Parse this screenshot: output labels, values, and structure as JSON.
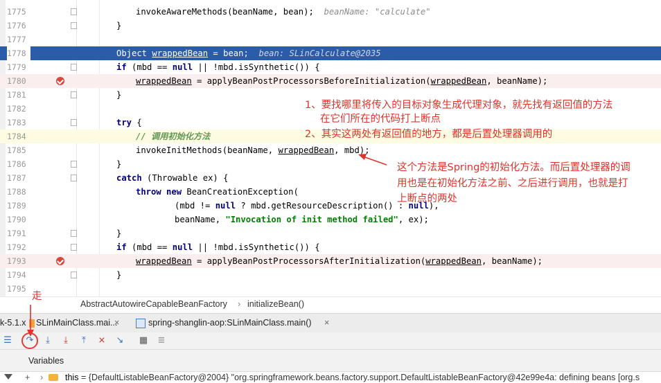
{
  "editor": {
    "lines": [
      {
        "num": "1775"
      },
      {
        "num": "1776"
      },
      {
        "num": "1777"
      },
      {
        "num": "1778"
      },
      {
        "num": "1779"
      },
      {
        "num": "1780"
      },
      {
        "num": "1781"
      },
      {
        "num": "1782"
      },
      {
        "num": "1783"
      },
      {
        "num": "1784"
      },
      {
        "num": "1785"
      },
      {
        "num": "1786"
      },
      {
        "num": "1787"
      },
      {
        "num": "1788"
      },
      {
        "num": "1789"
      },
      {
        "num": "1790"
      },
      {
        "num": "1791"
      },
      {
        "num": "1792"
      },
      {
        "num": "1793"
      },
      {
        "num": "1794"
      },
      {
        "num": "1795"
      }
    ],
    "tokens": {
      "invokeAware": "invokeAwareMethods(beanName, bean);",
      "hint_beanName": "beanName: \"calculate\"",
      "brace": "}",
      "object": "Object ",
      "wrappedBean": "wrappedBean",
      "eq_bean": " = bean;",
      "hint_bean": "bean: SLinCalculate@2035",
      "if": "if",
      "cond_open": " (mbd == ",
      "null": "null",
      "cond_rest": " || !mbd.isSynthetic()) {",
      "assign_before": " = applyBeanPostProcessorsBeforeInitialization(",
      "args_end": ", beanName);",
      "try": "try",
      "open_brace": " {",
      "comment_init": "// 调用初始化方法",
      "invoke_init_a": "invokeInitMethods(beanName, ",
      "invoke_init_b": ", mbd);",
      "close_brace": "}",
      "catch": "catch",
      "catch_rest": " (Throwable ex) {",
      "throw": "throw",
      "new": "new",
      "bce": " BeanCreationException(",
      "mbd_ne": "(mbd != ",
      "ternary": " ? mbd.getResourceDescription() : ",
      "paren_comma": "),",
      "beanname_comma": "beanName, ",
      "invocation_str": "\"Invocation of init method failed\"",
      "ex_end": ", ex);",
      "assign_after": " = applyBeanPostProcessorsAfterInitialization("
    },
    "annotations": {
      "note1": "1、要找哪里将传入的目标对象生成代理对象，就先找有返回值的方法",
      "note1b": "在它们所在的代码打上断点",
      "note2": "2、其实这两处有返回值的地方，都是后置处理器调用的",
      "note3a": "这个方法是Spring的初始化方法。而后置处理器的调",
      "note3b": "用也是在初始化方法之前、之后进行调用，也就是打",
      "note3c": "上断点的两处",
      "walk": "走"
    }
  },
  "breadcrumb": {
    "class_name": "AbstractAutowireCapableBeanFactory",
    "method": "initializeBean()"
  },
  "debug_tabs": {
    "tab_left": "k-5.1.x",
    "tab_mid": "SLinMainClass.mai...",
    "tab_active": "spring-shanglin-aop:SLinMainClass.main()"
  },
  "variables": {
    "header": "Variables",
    "row_name": "this",
    "row_value": " = {DefaultListableBeanFactory@2004} \"org.springframework.beans.factory.support.DefaultListableBeanFactory@42e99e4a: defining beans [org.s"
  },
  "colors": {
    "selected_row": "#2a5caa",
    "breakpoint": "#d8493d",
    "annotation": "#e0332a",
    "step_over_circle": "#e53935"
  }
}
